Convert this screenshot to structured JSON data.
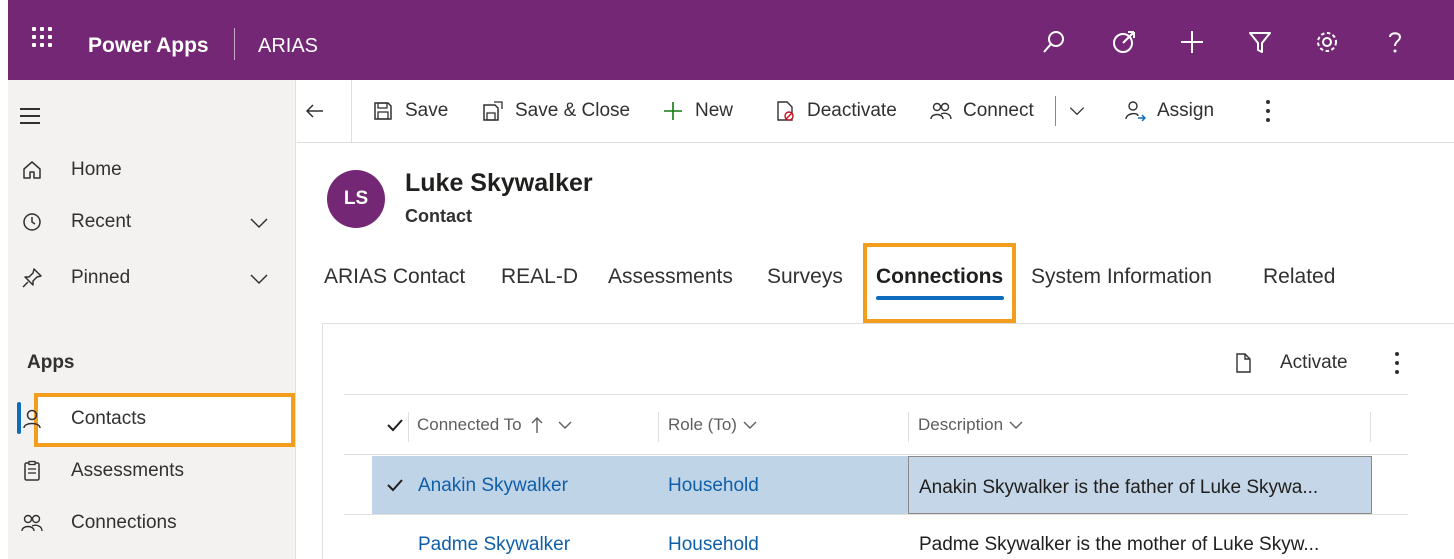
{
  "topbar": {
    "brand": "Power Apps",
    "app_name": "ARIAS",
    "icons": [
      "waffle-icon",
      "search-icon",
      "target-icon",
      "add-icon",
      "filter-icon",
      "settings-icon",
      "help-icon"
    ],
    "color": "#742774"
  },
  "sidebar": {
    "items": [
      {
        "label": "Home",
        "icon": "home-icon"
      },
      {
        "label": "Recent",
        "icon": "clock-icon",
        "expandable": true
      },
      {
        "label": "Pinned",
        "icon": "pin-icon",
        "expandable": true
      }
    ],
    "apps_heading": "Apps",
    "apps": [
      {
        "label": "Contacts",
        "icon": "person-icon",
        "selected": true
      },
      {
        "label": "Assessments",
        "icon": "clipboard-icon"
      },
      {
        "label": "Connections",
        "icon": "people-icon"
      }
    ]
  },
  "commandbar": {
    "save": "Save",
    "save_close": "Save & Close",
    "new": "New",
    "deactivate": "Deactivate",
    "connect": "Connect",
    "assign": "Assign"
  },
  "record": {
    "initials": "LS",
    "name": "Luke Skywalker",
    "type": "Contact"
  },
  "tabs": [
    "ARIAS Contact",
    "REAL-D",
    "Assessments",
    "Surveys",
    "Connections",
    "System Information",
    "Related"
  ],
  "active_tab": "Connections",
  "connections": {
    "activate_label": "Activate",
    "columns": [
      "Connected To",
      "Role (To)",
      "Description"
    ],
    "rows": [
      {
        "connected_to": "Anakin Skywalker",
        "role": "Household",
        "description": "Anakin Skywalker is the father of Luke Skywa...",
        "selected": true
      },
      {
        "connected_to": "Padme Skywalker",
        "role": "Household",
        "description": "Padme Skywalker is the mother of Luke Skyw...",
        "selected": false
      }
    ]
  },
  "colors": {
    "brand": "#742774",
    "highlight": "#f29e1c",
    "accent": "#0f6cbd",
    "selected_row": "#c0d4e8",
    "link": "#0f5fa8"
  }
}
